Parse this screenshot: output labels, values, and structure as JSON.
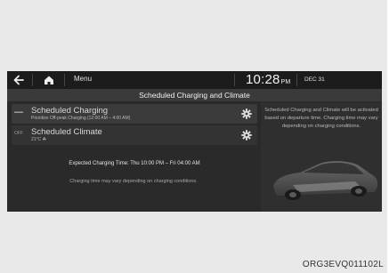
{
  "topbar": {
    "menu_label": "Menu",
    "time": "10:28",
    "ampm": "PM",
    "date": "DEC 31"
  },
  "title": "Scheduled Charging and Climate",
  "rows": [
    {
      "icon_label": "▬▬",
      "title": "Scheduled Charging",
      "subtitle": "Prioritize Off-peak Charging (12:00 AM – 4:00 AM)"
    },
    {
      "icon_label": "OFF",
      "title": "Scheduled Climate",
      "subtitle": "21°C ☘"
    }
  ],
  "expected_time": "Expected Charging Time: Thu 10:00 PM – Fri 04:00 AM",
  "note_left": "Charging time may vary depending on charging conditions.",
  "right_note": "Scheduled Charging and Climate will be activated based on departure time. Charging time may vary depending on charging conditions.",
  "caption": "ORG3EVQ011102L",
  "icons": {
    "back": "back-arrow-icon",
    "home": "home-icon",
    "gear": "gear-icon"
  },
  "colors": {
    "screen_bg": "#2a2a2a",
    "row_active": "#3b3b3b",
    "text_primary": "#f0f0f0"
  }
}
